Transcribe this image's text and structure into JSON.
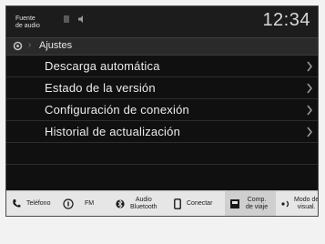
{
  "status_bar": {
    "audio_source_label": "Fuente\nde audio",
    "clock": "12:34"
  },
  "breadcrumb": {
    "title": "Ajustes"
  },
  "menu": {
    "items": [
      {
        "label": "Descarga automática"
      },
      {
        "label": "Estado de la versión"
      },
      {
        "label": "Configuración de conexión"
      },
      {
        "label": "Historial de actualización"
      }
    ]
  },
  "tab_bar": {
    "tabs": [
      {
        "label": "Teléfono",
        "icon": "phone-icon"
      },
      {
        "label": "FM",
        "icon": "radio-icon"
      },
      {
        "label": "Audio\nBluetooth",
        "icon": "bluetooth-icon"
      },
      {
        "label": "Conectar",
        "icon": "smartphone-icon"
      },
      {
        "label": "Comp.\nde viaje",
        "icon": "trip-computer-icon"
      },
      {
        "label": "Modo de\nvisual.",
        "icon": "display-mode-icon"
      }
    ],
    "active_tab": "Comp. de viaje"
  },
  "colors": {
    "screen_bg": "#101010",
    "text": "#ececec",
    "tab_bar_bg": "#e6e6e6"
  }
}
